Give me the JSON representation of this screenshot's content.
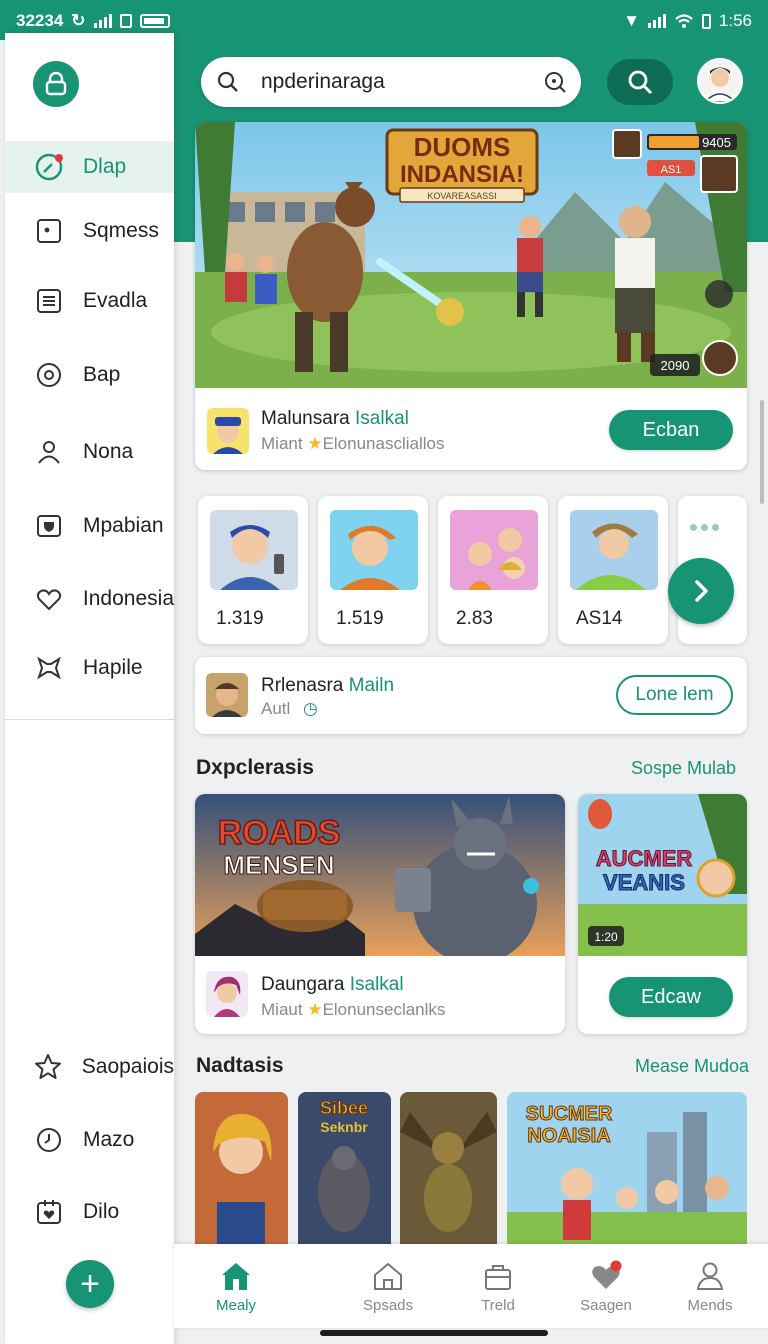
{
  "status_bar": {
    "time_left": "32234",
    "time_right": "1:56"
  },
  "search": {
    "value": "npderinaraga"
  },
  "sidebar": {
    "items": [
      {
        "label": "Dlap",
        "icon": "compass-icon",
        "active": true
      },
      {
        "label": "Sqmess",
        "icon": "square-dot-icon"
      },
      {
        "label": "Evadla",
        "icon": "list-icon"
      },
      {
        "label": "Bap",
        "icon": "circle-icon"
      },
      {
        "label": "Nona",
        "icon": "person-icon"
      },
      {
        "label": "Mpabian",
        "icon": "shield-icon"
      },
      {
        "label": "Indonesia",
        "icon": "heart-icon"
      },
      {
        "label": "Hapile",
        "icon": "puzzle-icon"
      }
    ],
    "bottom_items": [
      {
        "label": "Saopaiois",
        "icon": "star-icon"
      },
      {
        "label": "Mazo",
        "icon": "clock-icon"
      },
      {
        "label": "Dilo",
        "icon": "heart-box-icon"
      }
    ]
  },
  "hero": {
    "banner_title_1": "DUOMS",
    "banner_title_2": "INDANSIA!",
    "banner_ribbon": "KOVAREASASSI",
    "hud_score": "9405",
    "hud_small": "AS1",
    "hud_count": "2090",
    "app_name_a": "Malunsara",
    "app_name_b": "Isalkal",
    "app_sub_a": "Miant",
    "app_sub_b": "Elonunascliallos",
    "button": "Ecban"
  },
  "mini_cards": [
    {
      "value": "1.319"
    },
    {
      "value": "1.519"
    },
    {
      "value": "2.83"
    },
    {
      "value": "AS14"
    }
  ],
  "promo": {
    "title_a": "Rrlenasra",
    "title_b": "Mailn",
    "sub": "Autl",
    "button": "Lone lem"
  },
  "section1": {
    "title": "Dxpclerasis",
    "link": "Sospe Mulab"
  },
  "featured": {
    "main_title_1": "ROADS",
    "main_title_2": "MENSEN",
    "app_name_a": "Daungara",
    "app_name_b": "Isalkal",
    "app_sub_a": "Miaut",
    "app_sub_b": "Elonunseclanlks",
    "side_title_1": "AUCMER",
    "side_title_2": "VEANIS",
    "side_badge": "1:20",
    "side_button": "Edcaw"
  },
  "section2": {
    "title": "Nadtasis",
    "link": "Mease Mudoa"
  },
  "tiles": {
    "t2_title_1": "Sibee",
    "t2_title_2": "Seknbr",
    "t4_title_1": "SUCMER",
    "t4_title_2": "NOAISIA"
  },
  "bottom_nav": [
    {
      "label": "Mealy",
      "icon": "home-icon",
      "active": true
    },
    {
      "label": "Spsads",
      "icon": "house-outline-icon"
    },
    {
      "label": "Treld",
      "icon": "bag-icon"
    },
    {
      "label": "Saagen",
      "icon": "heart-icon"
    },
    {
      "label": "Mends",
      "icon": "person-icon"
    }
  ],
  "colors": {
    "accent": "#179474",
    "accent_dark": "#0f6c54"
  }
}
